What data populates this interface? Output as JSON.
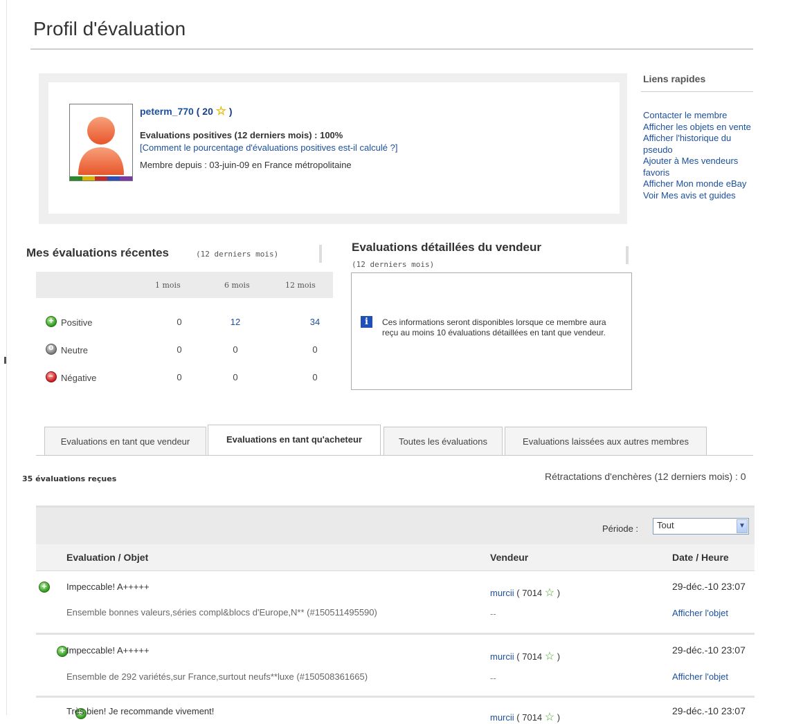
{
  "page_title": "Profil d'évaluation",
  "profile": {
    "username": "peterm_770",
    "score": "20",
    "positive_pct": "Evaluations positives (12 derniers mois) : 100%",
    "calc_link": "[Comment le pourcentage d'évaluations positives est-il calculé ?]",
    "member_since": "Membre depuis : 03-juin-09 en France métropolitaine"
  },
  "quick_links": {
    "title": "Liens rapides",
    "items": [
      "Contacter le membre",
      "Afficher les objets en vente",
      "Afficher l'historique du pseudo",
      "Ajouter à Mes vendeurs favoris",
      "Afficher Mon monde eBay",
      "Voir Mes avis et guides"
    ]
  },
  "recent": {
    "title": "Mes évaluations récentes",
    "subtitle": "(12 derniers mois)",
    "columns": [
      "1 mois",
      "6 mois",
      "12 mois"
    ],
    "rows": [
      {
        "label": "Positive",
        "v1": "0",
        "v6": "12",
        "v12": "34"
      },
      {
        "label": "Neutre",
        "v1": "0",
        "v6": "0",
        "v12": "0"
      },
      {
        "label": "Négative",
        "v1": "0",
        "v6": "0",
        "v12": "0"
      }
    ]
  },
  "detailed": {
    "title": "Evaluations détaillées du vendeur",
    "subtitle": "(12 derniers mois)",
    "info_icon": "i",
    "message": "Ces informations seront disponibles lorsque ce membre aura reçu au moins 10 évaluations détaillées en tant que vendeur."
  },
  "tabs": [
    "Evaluations en tant que vendeur",
    "Evaluations en tant qu'acheteur",
    "Toutes les évaluations",
    "Evaluations laissées aux autres membres"
  ],
  "received": "35 évaluations reçues",
  "retractions": "Rétractations d'enchères (12 derniers mois) : 0",
  "period": {
    "label": "Période :",
    "value": "Tout"
  },
  "table": {
    "headers": [
      "Evaluation / Objet",
      "Vendeur",
      "Date / Heure"
    ],
    "rows": [
      {
        "comment": "Impeccable! A+++++",
        "item": "Ensemble bonnes valeurs,séries compl&blocs d'Europe,N** (#150511495590)",
        "seller": "murcii",
        "seller_score": "7014",
        "dash": "--",
        "date": "29-déc.-10 23:07",
        "view": "Afficher l'objet"
      },
      {
        "comment": "Impeccable! A+++++",
        "item": "Ensemble de 292 variétés,sur France,surtout neufs**luxe (#150508361665)",
        "seller": "murcii",
        "seller_score": "7014",
        "dash": "--",
        "date": "29-déc.-10 23:07",
        "view": "Afficher l'objet"
      },
      {
        "comment": "Très bien! Je recommande vivement!",
        "seller": "murcii",
        "seller_score": "7014",
        "date": "29-déc.-10 23:07"
      }
    ]
  },
  "colors": {
    "link": "#1c4f9c",
    "username": "#1a3c8a",
    "positive": "#2e9a1e",
    "neutral": "#777777",
    "negative": "#cc1a1a",
    "info": "#1f4fb8"
  }
}
